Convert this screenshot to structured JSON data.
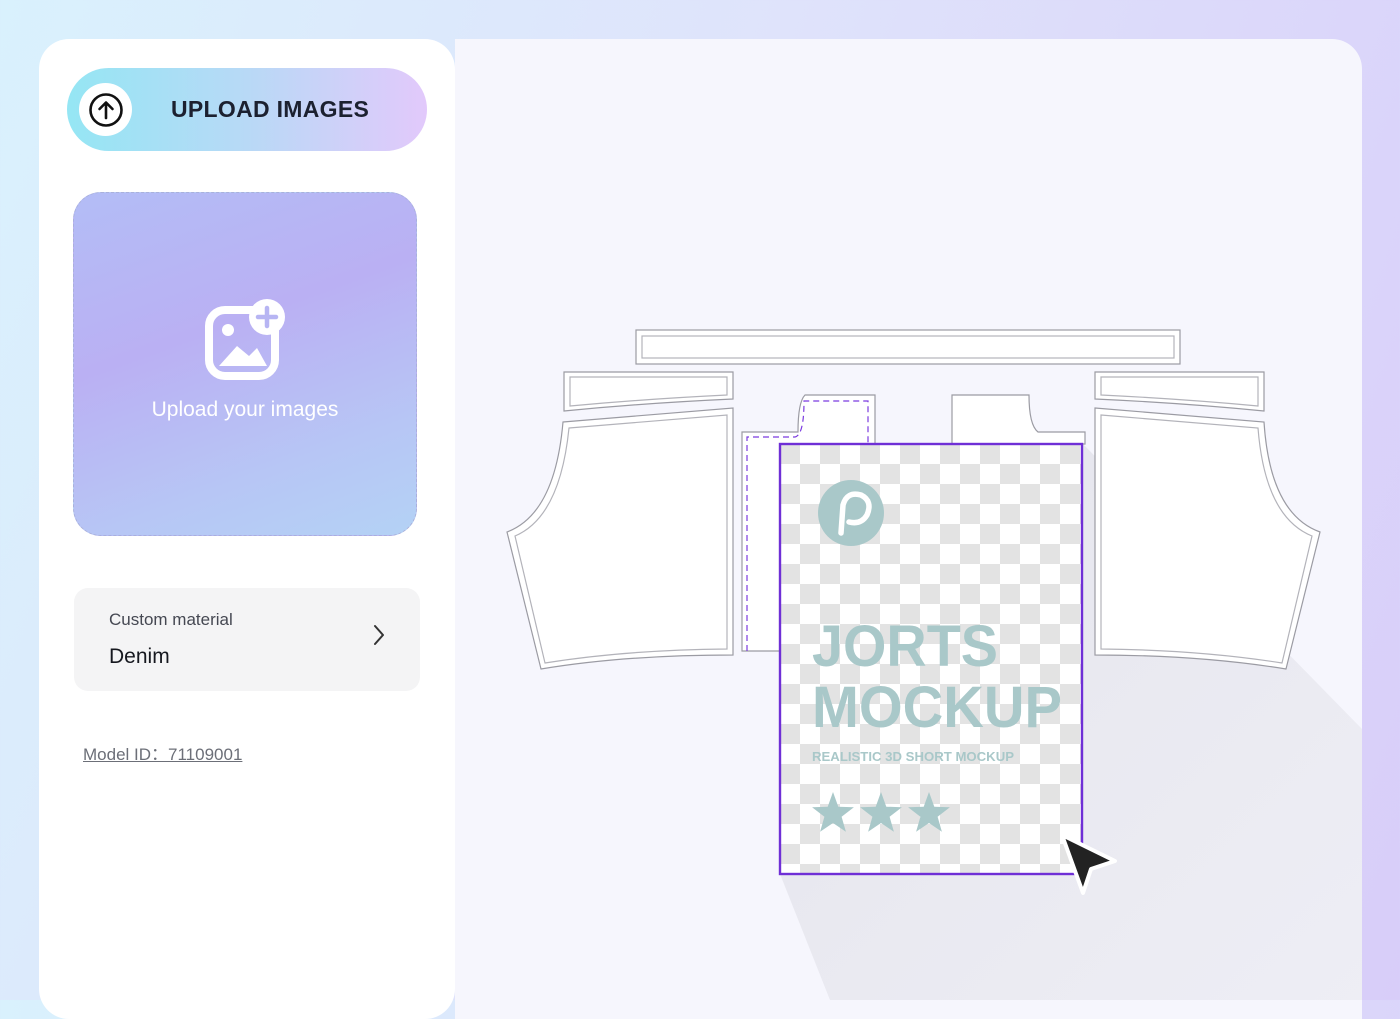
{
  "sidebar": {
    "upload_button": {
      "label": "UPLOAD IMAGES",
      "icon": "arrow-up-circle-icon"
    },
    "dropzone": {
      "text": "Upload your images",
      "icon": "image-add-icon"
    },
    "material": {
      "label": "Custom material",
      "value": "Denim",
      "icon": "chevron-right-icon"
    },
    "model_id": "Model ID：71109001"
  },
  "artwork": {
    "title_line1": "JORTS",
    "title_line2": "MOCKUP",
    "subtitle": "REALISTIC 3D SHORT MOCKUP",
    "rating_stars": 3,
    "logo_icon": "brand-logo-icon"
  },
  "colors": {
    "selection_border": "#6f2fd6",
    "art_text": "#a9c8c9",
    "cursor": "#222222"
  }
}
